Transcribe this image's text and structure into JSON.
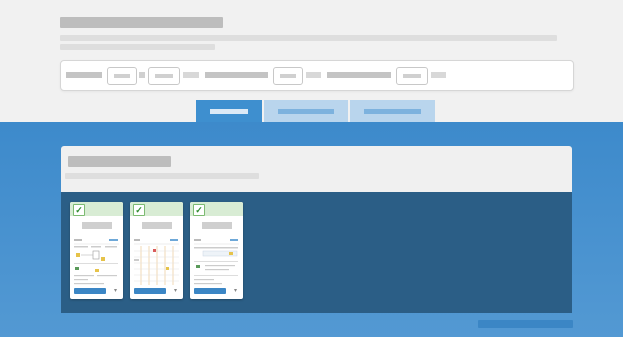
{
  "theme": {
    "accent": "#3e8fcf",
    "tab_inactive": "#b9d5ed",
    "panel_dark": "#2b5e86",
    "card_header": "#d8ecd4",
    "check": "#2e8b2e"
  },
  "header": {
    "title": "",
    "description": ""
  },
  "filter_bar": {
    "filters": [
      {
        "label": "",
        "value": ""
      },
      {
        "label": "",
        "value": ""
      },
      {
        "label": "",
        "value": ""
      },
      {
        "label": "",
        "value": ""
      }
    ]
  },
  "tabs": [
    {
      "label": "",
      "active": true
    },
    {
      "label": "",
      "active": false
    },
    {
      "label": "",
      "active": false
    }
  ],
  "panel": {
    "title": "",
    "subtitle": ""
  },
  "cards": [
    {
      "checked": true,
      "check_glyph": "✓",
      "title": "",
      "button_label": "",
      "menu_glyph": "▾",
      "icon": "check-icon"
    },
    {
      "checked": true,
      "check_glyph": "✓",
      "title": "",
      "button_label": "",
      "menu_glyph": "▾",
      "icon": "check-icon"
    },
    {
      "checked": true,
      "check_glyph": "✓",
      "title": "",
      "button_label": "",
      "menu_glyph": "▾",
      "icon": "check-icon"
    }
  ],
  "footer": {
    "link_label": ""
  }
}
